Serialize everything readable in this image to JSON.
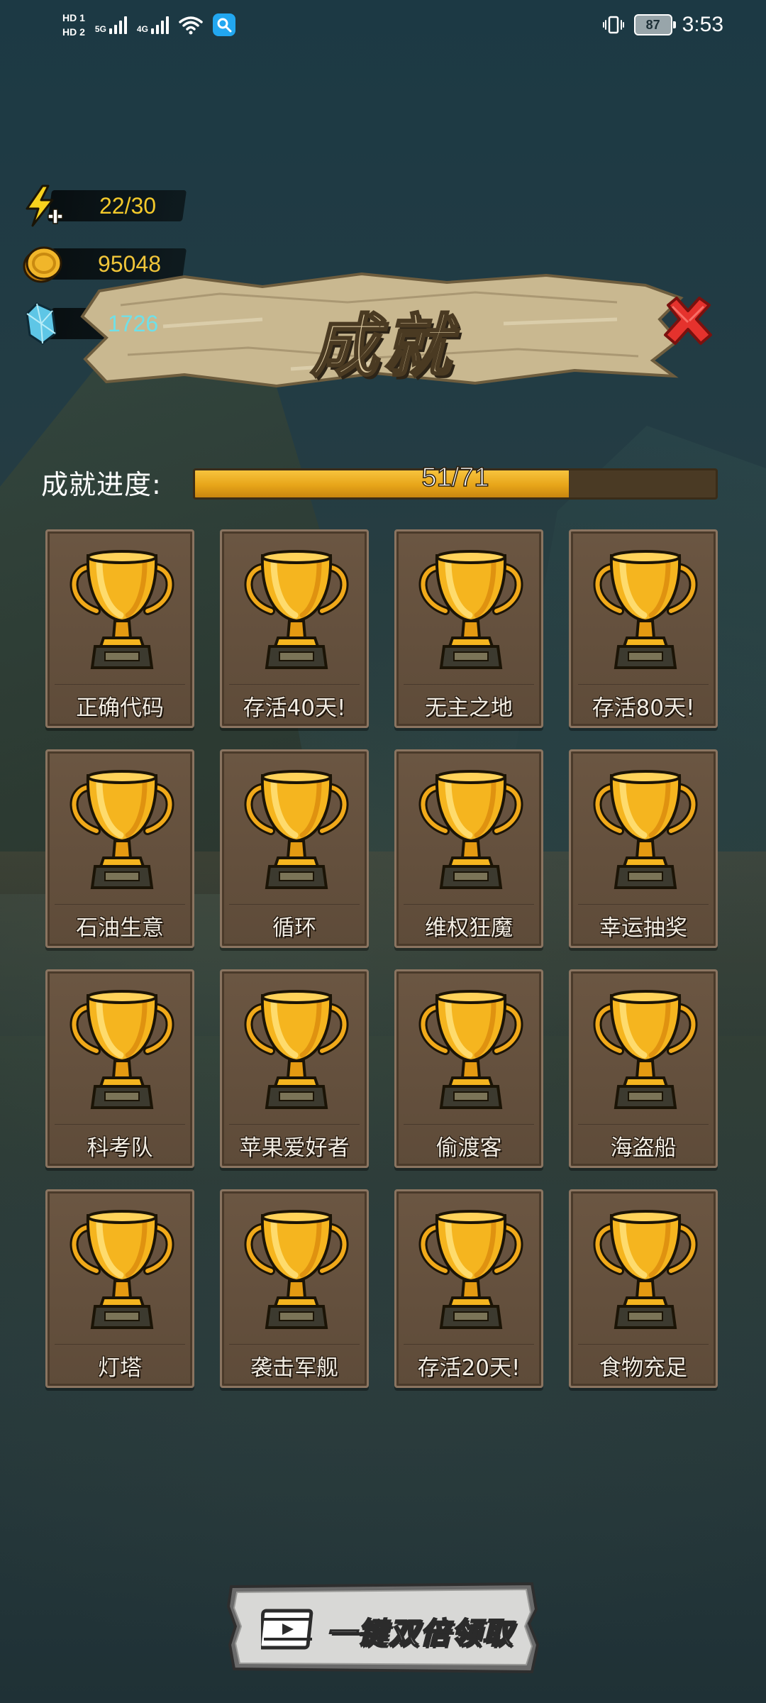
{
  "status_bar": {
    "sim1": "HD 1",
    "sim2": "HD 2",
    "net1": "5G",
    "net2": "4G",
    "battery": "87",
    "time": "3:53"
  },
  "resources": {
    "energy": "22/30",
    "coins": "95048",
    "gems": "1726"
  },
  "title": "成就",
  "progress": {
    "label": "成就进度:",
    "text": "51/71",
    "current": 51,
    "total": 71
  },
  "achievements": [
    {
      "name": "正确代码"
    },
    {
      "name": "存活40天!"
    },
    {
      "name": "无主之地"
    },
    {
      "name": "存活80天!"
    },
    {
      "name": "石油生意"
    },
    {
      "name": "循环"
    },
    {
      "name": "维权狂魔"
    },
    {
      "name": "幸运抽奖"
    },
    {
      "name": "科考队"
    },
    {
      "name": "苹果爱好者"
    },
    {
      "name": "偷渡客"
    },
    {
      "name": "海盗船"
    },
    {
      "name": "灯塔"
    },
    {
      "name": "袭击军舰"
    },
    {
      "name": "存活20天!"
    },
    {
      "name": "食物充足"
    }
  ],
  "claim_button": {
    "label": "一键双倍领取"
  },
  "colors": {
    "gold": "#e7a519",
    "energy": "#f3c92b",
    "gem": "#6fe0e8",
    "close": "#e5322d",
    "card": "#5e4b39"
  }
}
